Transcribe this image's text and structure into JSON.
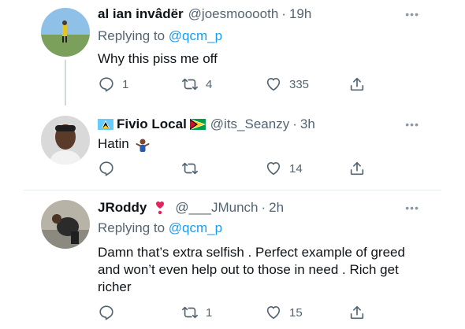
{
  "tweets": [
    {
      "name": "al ian invâdër",
      "handle": "@joesmooooth",
      "time": "19h",
      "replying_prefix": "Replying to",
      "replying_to": "@qcm_p",
      "text": "Why this piss me off",
      "replies": "1",
      "retweets": "4",
      "likes": "335"
    },
    {
      "name": "Fivio Local",
      "handle": "@its_Seanzy",
      "time": "3h",
      "text": "Hatin",
      "replies": "",
      "retweets": "",
      "likes": "14"
    },
    {
      "name": "JRoddy",
      "handle": "@___JMunch",
      "time": "2h",
      "replying_prefix": "Replying to",
      "replying_to": "@qcm_p",
      "text": "Damn that’s extra selfish . Perfect example of greed and won’t even help out to those in need . Rich get richer",
      "replies": "",
      "retweets": "1",
      "likes": "15"
    }
  ],
  "separator": "·",
  "more_glyph": "•••",
  "colors": {
    "link": "#1d9bf0",
    "muted": "#536471",
    "text": "#0f1419",
    "thread_line": "#cfd9de"
  }
}
